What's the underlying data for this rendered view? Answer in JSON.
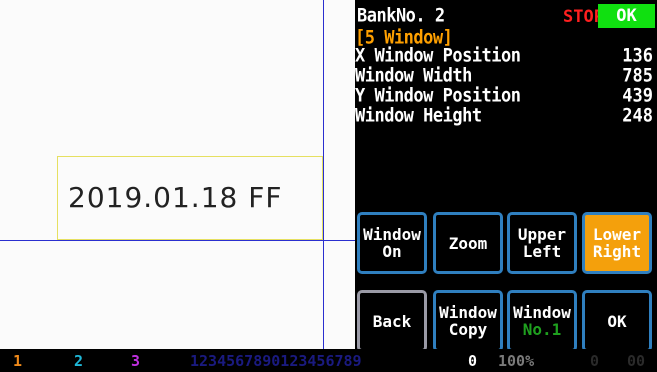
{
  "viewer": {
    "roi_text": "2019.01.18 FF"
  },
  "panel": {
    "bank_label": "BankNo.",
    "bank_number": "2",
    "stop_label": "STOP",
    "ok_label": "OK",
    "section_title": "[5 Window]",
    "params": [
      {
        "label": "X Window Position",
        "value": "136"
      },
      {
        "label": "Window Width",
        "value": "785"
      },
      {
        "label": "Y Window Position",
        "value": "439"
      },
      {
        "label": "Window Height",
        "value": "248"
      }
    ],
    "buttons_row1": [
      {
        "line1": "Window",
        "line2": "On"
      },
      {
        "line1": "Zoom",
        "line2": ""
      },
      {
        "line1": "Upper",
        "line2": "Left"
      },
      {
        "line1": "Lower",
        "line2": "Right"
      }
    ],
    "buttons_row2": [
      {
        "line1": "Back",
        "line2": ""
      },
      {
        "line1": "Window",
        "line2": "Copy"
      },
      {
        "line1": "Window",
        "line2": "No.1"
      },
      {
        "line1": "OK",
        "line2": ""
      }
    ]
  },
  "statusbar": {
    "bank1": "1",
    "bank2": "2",
    "bank3": "3",
    "digits": "1234567890123456789",
    "count": "0",
    "percent": "100%",
    "tail1": "0",
    "tail2": "00"
  },
  "colors": {
    "accent_active": "#f4a00c",
    "button_border": "#2f7fbf",
    "stop": "#ff1f1f",
    "ok": "#10e010",
    "section_title": "#ffa000"
  }
}
